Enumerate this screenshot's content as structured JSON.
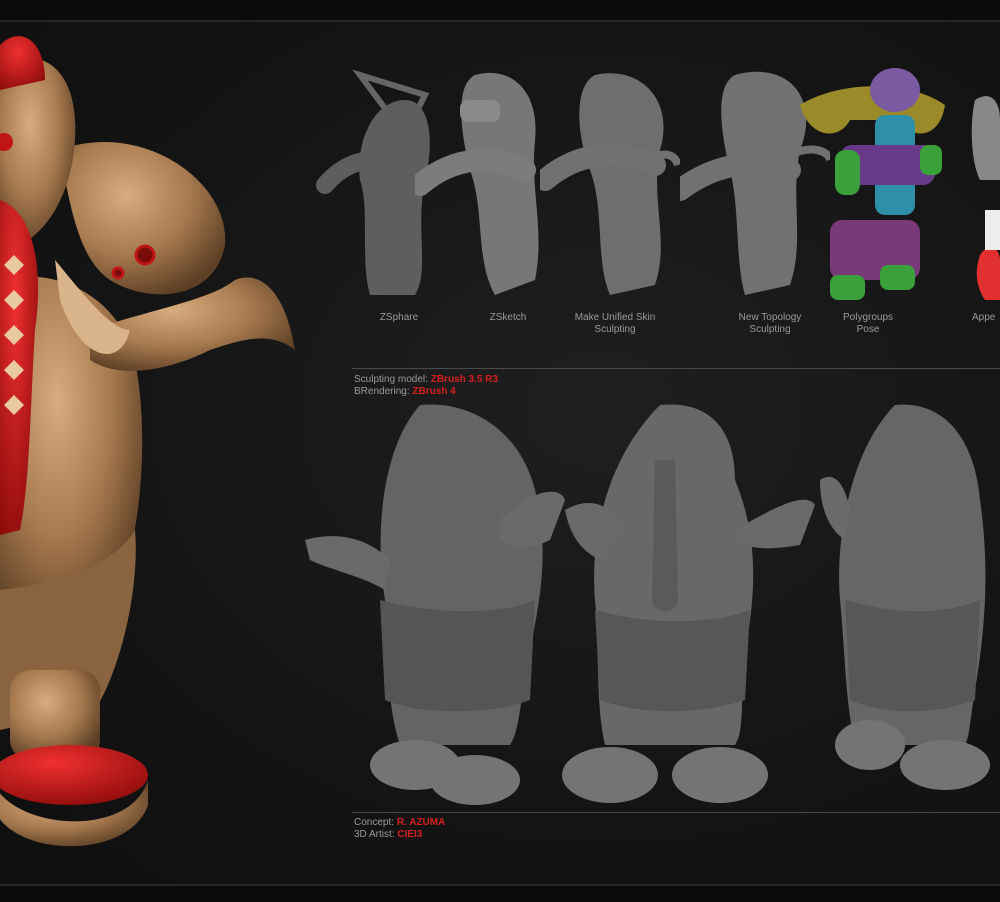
{
  "stages": [
    {
      "label": "ZSphare"
    },
    {
      "label": "ZSketch"
    },
    {
      "label": "Make Unified Skin\nSculpting"
    },
    {
      "label": "New Topology\nSculpting"
    },
    {
      "label": "Polygroups\nPose"
    },
    {
      "label": "Appe"
    }
  ],
  "credits_top": {
    "model_label": "Sculpting model:",
    "model_value": "ZBrush 3.5 R3",
    "render_label": "BRendering:",
    "render_value": "ZBrush 4"
  },
  "credits_bottom": {
    "concept_label": "Concept:",
    "concept_value": "R. AZUMA",
    "artist_label": "3D Artist:",
    "artist_value": "CIEI3"
  },
  "colors": {
    "accent_red": "#d42020",
    "skin_bronze": "#b08257",
    "clay_grey": "#6f6f6f"
  }
}
